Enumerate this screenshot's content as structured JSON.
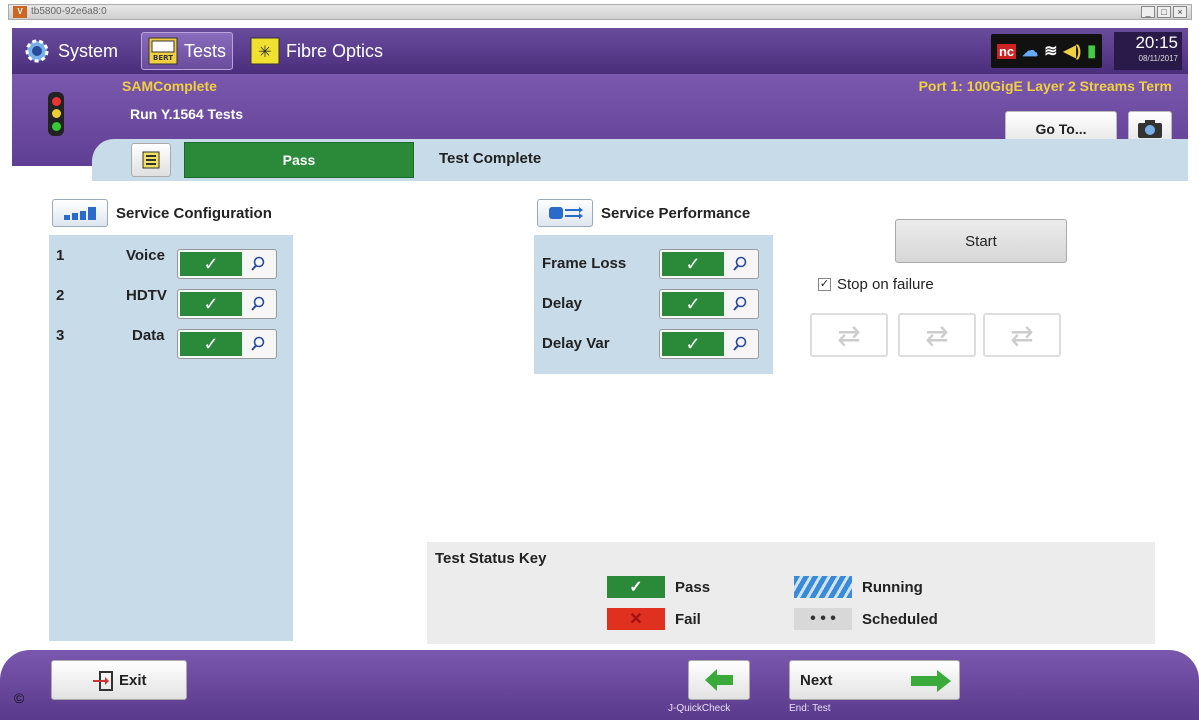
{
  "window": {
    "title": "tb5800-92e6a8:0"
  },
  "topbar": {
    "tabs": [
      {
        "label": "System",
        "icon": "gear-icon"
      },
      {
        "label": "Tests",
        "icon": "bert-icon"
      },
      {
        "label": "Fibre Optics",
        "icon": "laser-icon"
      }
    ],
    "status_nc": "nc",
    "time": "20:15",
    "date": "08/11/2017"
  },
  "header": {
    "app_title": "SAMComplete",
    "subtitle": "Run Y.1564 Tests",
    "port": "Port 1: 100GigE Layer 2 Streams Term",
    "goto_label": "Go To..."
  },
  "status": {
    "result": "Pass",
    "message": "Test Complete"
  },
  "service_configuration": {
    "title": "Service Configuration",
    "items": [
      {
        "index": "1",
        "label": "Voice"
      },
      {
        "index": "2",
        "label": "HDTV"
      },
      {
        "index": "3",
        "label": "Data"
      }
    ]
  },
  "service_performance": {
    "title": "Service Performance",
    "items": [
      {
        "label": "Frame Loss"
      },
      {
        "label": "Delay"
      },
      {
        "label": "Delay Var"
      }
    ]
  },
  "controls": {
    "start_label": "Start",
    "stop_on_failure_label": "Stop on failure",
    "stop_on_failure_checked": true
  },
  "status_key": {
    "title": "Test Status Key",
    "items": [
      {
        "label": "Pass",
        "color": "#2a8a3a"
      },
      {
        "label": "Running",
        "color": "#3a8ad8"
      },
      {
        "label": "Fail",
        "color": "#e03020"
      },
      {
        "label": "Scheduled",
        "color": "#d8d8d8"
      }
    ]
  },
  "footer": {
    "exit_label": "Exit",
    "back_caption": "J-QuickCheck",
    "next_label": "Next",
    "next_caption": "End: Test"
  },
  "copyright": "©"
}
